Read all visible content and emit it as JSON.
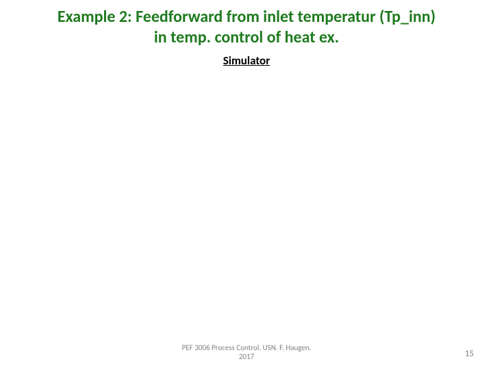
{
  "title_line1": "Example 2: Feedforward from inlet temperatur (Tp_inn)",
  "title_line2": "in temp. control of heat ex.",
  "simulator_label": "Simulator",
  "footer_line1": "PEF 3006 Process Control. USN. F. Haugen.",
  "footer_line2": "2017",
  "page_number": "15"
}
